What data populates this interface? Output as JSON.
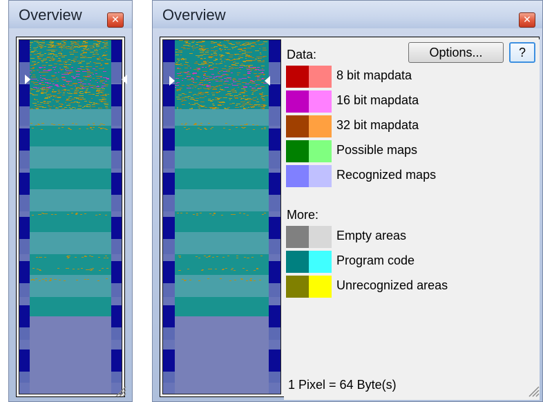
{
  "colors": {
    "window_border": "#7a8aa8",
    "map_background": "#0a0a8a",
    "program_code": "#128c8c",
    "empty": "#6f7fb8"
  },
  "left_window": {
    "title": "Overview",
    "close_icon": "close-icon"
  },
  "right_window": {
    "title": "Overview",
    "close_icon": "close-icon",
    "options_button": "Options...",
    "help_button": "?",
    "data_section": {
      "label": "Data:",
      "items": [
        {
          "label": "8 bit mapdata",
          "dark": "#c00000",
          "light": "#ff8080"
        },
        {
          "label": "16 bit mapdata",
          "dark": "#c000c0",
          "light": "#ff80ff"
        },
        {
          "label": "32 bit mapdata",
          "dark": "#a04000",
          "light": "#ffa040"
        },
        {
          "label": "Possible maps",
          "dark": "#008000",
          "light": "#80ff80"
        },
        {
          "label": "Recognized maps",
          "dark": "#8080ff",
          "light": "#c0c0ff"
        }
      ]
    },
    "more_section": {
      "label": "More:",
      "items": [
        {
          "label": "Empty areas",
          "dark": "#808080",
          "light": "#d8d8d8"
        },
        {
          "label": "Program code",
          "dark": "#008080",
          "light": "#40ffff"
        },
        {
          "label": "Unrecognized areas",
          "dark": "#808000",
          "light": "#ffff00"
        }
      ]
    },
    "footer": "1 Pixel = 64 Byte(s)"
  }
}
